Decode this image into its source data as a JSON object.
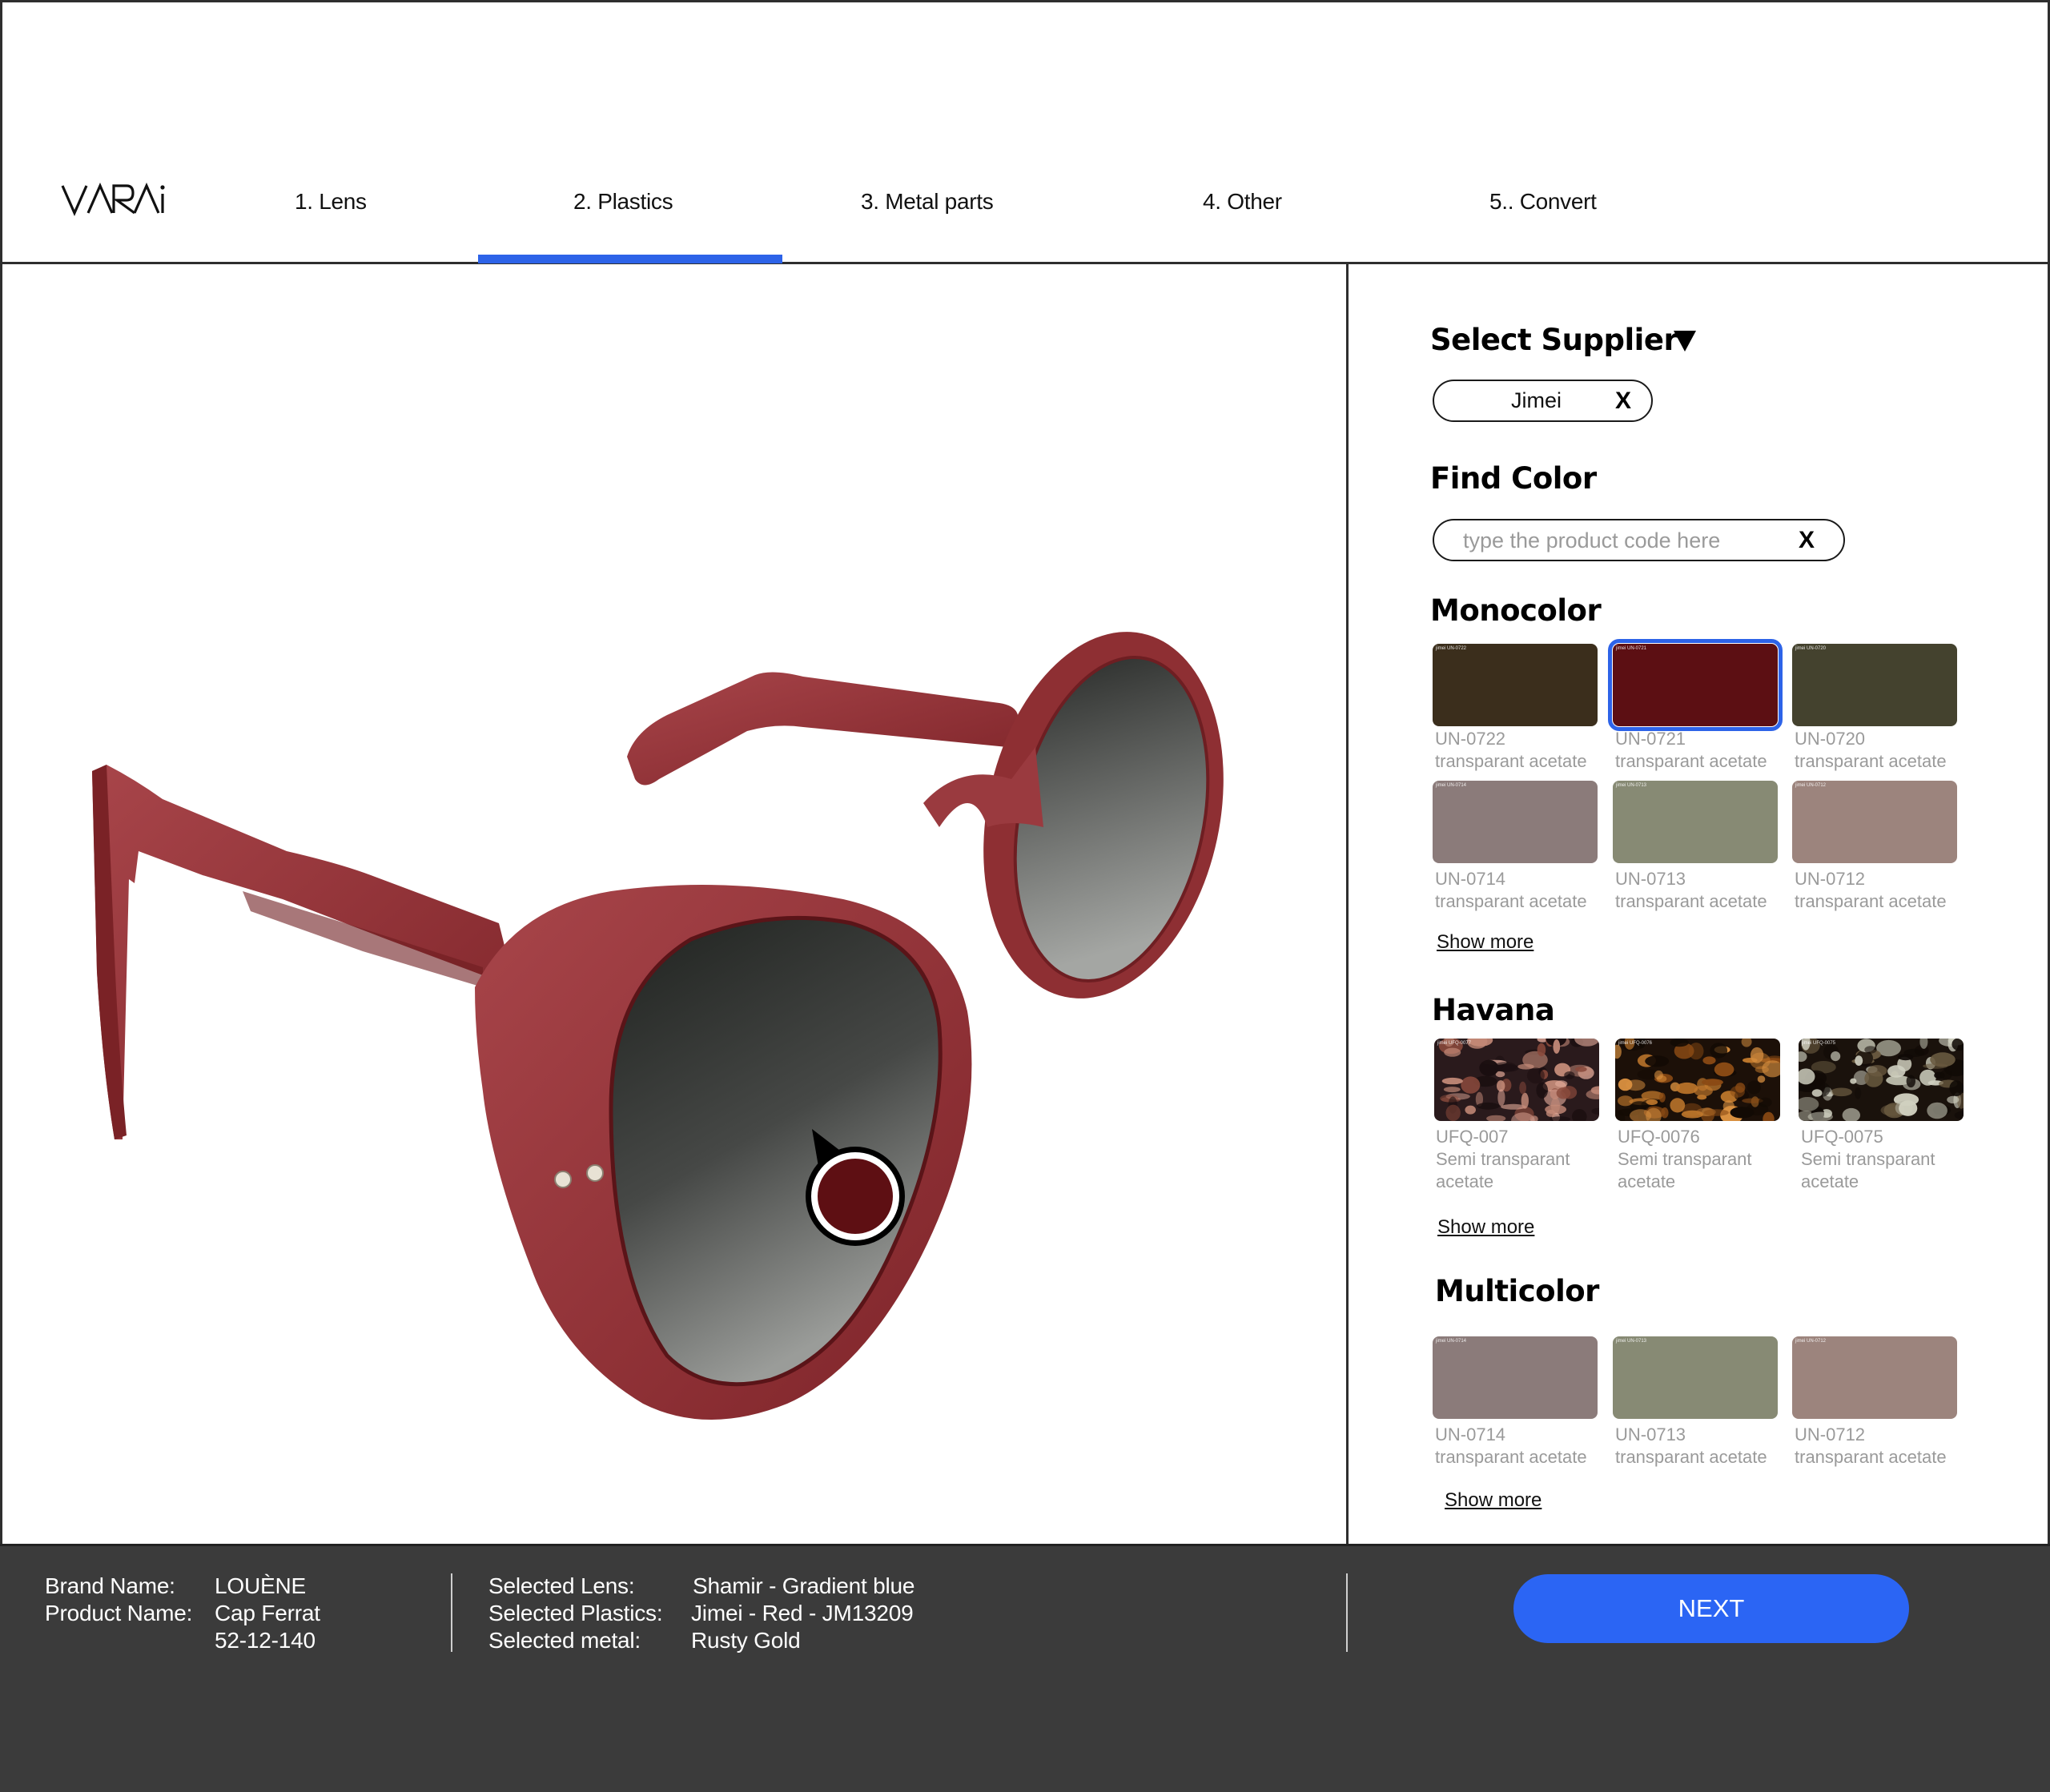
{
  "header": {
    "logo_text": "VARAi",
    "tabs": [
      {
        "label": "1. Lens",
        "active": false
      },
      {
        "label": "2. Plastics",
        "active": true
      },
      {
        "label": "3. Metal parts",
        "active": false
      },
      {
        "label": "4. Other",
        "active": false
      },
      {
        "label": "5.. Convert",
        "active": false
      }
    ],
    "accent_color": "#2d63e8"
  },
  "viewer": {
    "product_image": "red-round-acetate-sunglasses",
    "frame_color": "#8e2f33",
    "lens_color": "gradient-grey",
    "color_marker": {
      "color": "#5e0f13",
      "icon": "color-picker-pin"
    }
  },
  "panel": {
    "supplier": {
      "title": "Select Supplier",
      "dropdown_icon": "triangle-down",
      "selected_value": "Jimei",
      "clear_label": "X"
    },
    "find_color": {
      "title": "Find Color",
      "placeholder": "type the product code here",
      "value": "",
      "clear_label": "X"
    },
    "sections": [
      {
        "title": "Monocolor",
        "show_more": "Show more",
        "items": [
          {
            "code": "UN-0722",
            "desc": "transparant acetate",
            "color": "#3b2e1c",
            "tag": "jimei UN-0722",
            "selected": false
          },
          {
            "code": "UN-0721",
            "desc": "transparant acetate",
            "color": "#5c0f13",
            "tag": "jimei UN-0721",
            "selected": true
          },
          {
            "code": "UN-0720",
            "desc": "transparant acetate",
            "color": "#44422e",
            "tag": "jimei UN-0720",
            "selected": false
          },
          {
            "code": "UN-0714",
            "desc": "transparant acetate",
            "color": "#8b7b7a",
            "tag": "jimei UN-0714",
            "selected": false
          },
          {
            "code": "UN-0713",
            "desc": "transparant acetate",
            "color": "#878a74",
            "tag": "jimei UN-0713",
            "selected": false
          },
          {
            "code": "UN-0712",
            "desc": "transparant acetate",
            "color": "#9c847d",
            "tag": "jimei UN-0712",
            "selected": false
          }
        ]
      },
      {
        "title": "Havana",
        "show_more": "Show more",
        "items": [
          {
            "code": "UFQ-007",
            "desc": "Semi transparant acetate",
            "pattern": "tortoise-pink",
            "tag": "jimei UFQ-0077"
          },
          {
            "code": "UFQ-0076",
            "desc": "Semi transparant acetate",
            "pattern": "tortoise-amber",
            "tag": "jimei UFQ-0076"
          },
          {
            "code": "UFQ-0075",
            "desc": "Semi transparant acetate",
            "pattern": "tortoise-grey",
            "tag": "jimei UFQ-0075"
          }
        ]
      },
      {
        "title": "Multicolor",
        "show_more": "Show more",
        "items": [
          {
            "code": "UN-0714",
            "desc": "transparant acetate",
            "color": "#8b7b7a",
            "tag": "jimei UN-0714"
          },
          {
            "code": "UN-0713",
            "desc": "transparant acetate",
            "color": "#878a74",
            "tag": "jimei UN-0713"
          },
          {
            "code": "UN-0712",
            "desc": "transparant acetate",
            "color": "#9c847d",
            "tag": "jimei UN-0712"
          }
        ]
      }
    ]
  },
  "footer": {
    "product": {
      "brand_label": "Brand Name:",
      "brand_value": "LOUÈNE",
      "product_label": "Product Name:",
      "product_value": "Cap Ferrat",
      "size_value": "52-12-140"
    },
    "selection": {
      "lens_label": "Selected Lens:",
      "lens_value": "Shamir - Gradient blue",
      "plastics_label": "Selected Plastics:",
      "plastics_value": "Jimei - Red - JM13209",
      "metal_label": "Selected metal:",
      "metal_value": "Rusty Gold"
    },
    "next_label": "NEXT",
    "next_color": "#2b65f4"
  }
}
